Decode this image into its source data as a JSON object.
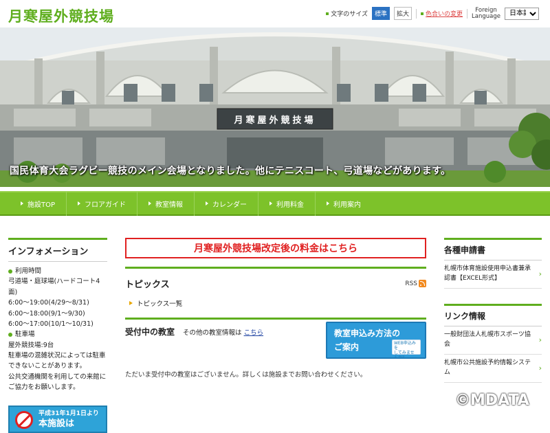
{
  "header": {
    "site_title": "月寒屋外競技場",
    "font_size_label": "文字のサイズ",
    "size_standard": "標準",
    "size_large": "拡大",
    "color_change": "色合いの変更",
    "foreign_language_line1": "Foreign",
    "foreign_language_line2": "Language",
    "language_selected": "日本語"
  },
  "hero": {
    "building_sign": "月寒屋外競技場",
    "caption": "国民体育大会ラグビー競技のメイン会場となりました。他にテニスコート、弓道場などがあります。"
  },
  "nav": {
    "items": [
      {
        "label": "施設TOP"
      },
      {
        "label": "フロアガイド"
      },
      {
        "label": "教室情報"
      },
      {
        "label": "カレンダー"
      },
      {
        "label": "利用料金"
      },
      {
        "label": "利用案内"
      }
    ]
  },
  "left": {
    "title": "インフォメーション",
    "hours_head": "利用時間",
    "hours_lines": [
      "弓道場・庭球場(ハードコート4面)",
      "6:00～19:00(4/29～8/31)",
      "6:00～18:00(9/1～9/30)",
      "6:00～17:00(10/1～10/31)"
    ],
    "parking_head": "駐車場",
    "parking_lines": [
      "屋外競技場:9台",
      "駐車場の混雑状況によっては駐車",
      "できないことがあります。",
      "公共交通機関を利用しての来館に",
      "ご協力をお願いします。"
    ],
    "banner_line1": "平成31年1月1日より",
    "banner_line2": "本施設は"
  },
  "main": {
    "fee_banner": "月寒屋外競技場改定後の料金はこちら",
    "topics_title": "トピックス",
    "rss_label": "RSS",
    "topics_list_link": "トピックス一覧",
    "class_title": "受付中の教室",
    "other_class_text": "その他の教室情報は",
    "other_class_link": "こちら",
    "class_banner_line1": "教室申込み方法の",
    "class_banner_line2": "ご案内",
    "class_banner_sub1": "WEB申込みを",
    "class_banner_sub2": "してみませんか?",
    "empty_message": "ただいま受付中の教室はございません。詳しくは施設までお問い合わせください。"
  },
  "right": {
    "forms_title": "各種申請書",
    "forms_item": "札幌市体育施設使用申込書兼承認書【EXCEL形式】",
    "links_title": "リンク情報",
    "links": [
      "一般財団法人札幌市スポーツ協会",
      "札幌市公共施設予約情報システム"
    ]
  },
  "watermark": "©MDATA",
  "colors": {
    "brand_green": "#5fae1e",
    "nav_green": "#7dc22a",
    "alert_red": "#e02020",
    "banner_blue": "#2d9bd9"
  }
}
